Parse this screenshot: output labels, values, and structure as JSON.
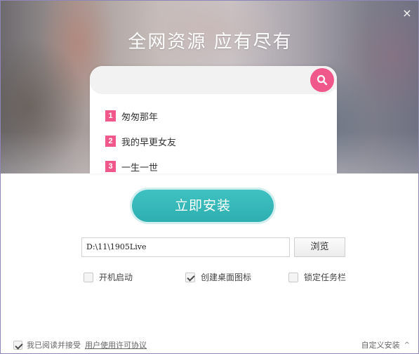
{
  "window": {
    "close_glyph": "×"
  },
  "banner": {
    "slogan": "全网资源  应有尽有"
  },
  "search": {
    "placeholder": "",
    "button_icon": "search-icon",
    "accent": "#f0578a",
    "suggestions": [
      {
        "rank": "1",
        "label": "匆匆那年"
      },
      {
        "rank": "2",
        "label": "我的早更女友"
      },
      {
        "rank": "3",
        "label": "一生一世"
      }
    ]
  },
  "install": {
    "button_label": "立即安装",
    "color": "#2eaeb0"
  },
  "path": {
    "value": "D:\\11\\1905Live",
    "browse_label": "浏览"
  },
  "options": [
    {
      "label": "开机启动",
      "checked": false
    },
    {
      "label": "创建桌面图标",
      "checked": true
    },
    {
      "label": "锁定任务栏",
      "checked": false
    }
  ],
  "footer": {
    "agree_text": "我已阅读并接受",
    "agree_checked": true,
    "license_link": "用户使用许可协议",
    "custom_install": "自定义安装",
    "custom_chevron": "^"
  }
}
